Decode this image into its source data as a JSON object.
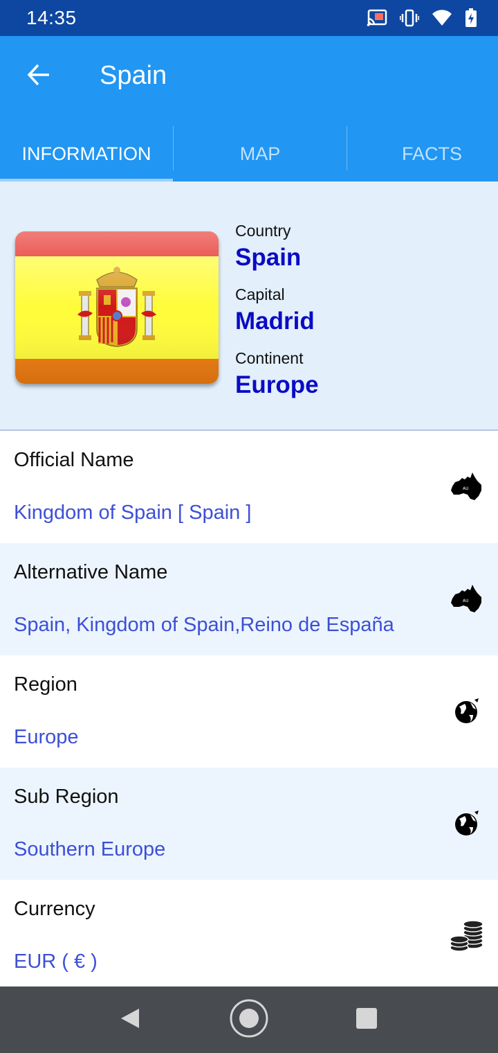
{
  "status_bar": {
    "time": "14:35",
    "icons": [
      "cast-icon",
      "vibrate-icon",
      "wifi-icon",
      "battery-icon"
    ]
  },
  "app_bar": {
    "title": "Spain",
    "back_icon": "arrow-back-icon"
  },
  "tabs": [
    {
      "label": "INFORMATION",
      "active": true
    },
    {
      "label": "MAP",
      "active": false
    },
    {
      "label": "FACTS",
      "active": false
    }
  ],
  "summary": {
    "country_label": "Country",
    "country_value": "Spain",
    "capital_label": "Capital",
    "capital_value": "Madrid",
    "continent_label": "Continent",
    "continent_value": "Europe"
  },
  "details": [
    {
      "label": "Official Name",
      "value": "Kingdom of Spain [ Spain ]",
      "icon": "australia-map-icon"
    },
    {
      "label": "Alternative Name",
      "value": "Spain, Kingdom of Spain,Reino de España",
      "icon": "australia-map-icon"
    },
    {
      "label": "Region",
      "value": "Europe",
      "icon": "globe-icon"
    },
    {
      "label": "Sub Region",
      "value": "Southern Europe",
      "icon": "globe-icon"
    },
    {
      "label": "Currency",
      "value": "EUR ( € )",
      "icon": "coins-icon"
    }
  ],
  "nav_bar": {
    "icons": [
      "back-triangle-icon",
      "home-circle-icon",
      "recents-square-icon"
    ]
  },
  "colors": {
    "status_bar": "#0d47a1",
    "app_bar": "#2196f3",
    "summary_bg": "#e3effb",
    "value_blue": "#0b0bc4",
    "detail_value": "#3d4fd6",
    "alt_row": "#ecf5fd",
    "nav_bar": "#484b50"
  }
}
